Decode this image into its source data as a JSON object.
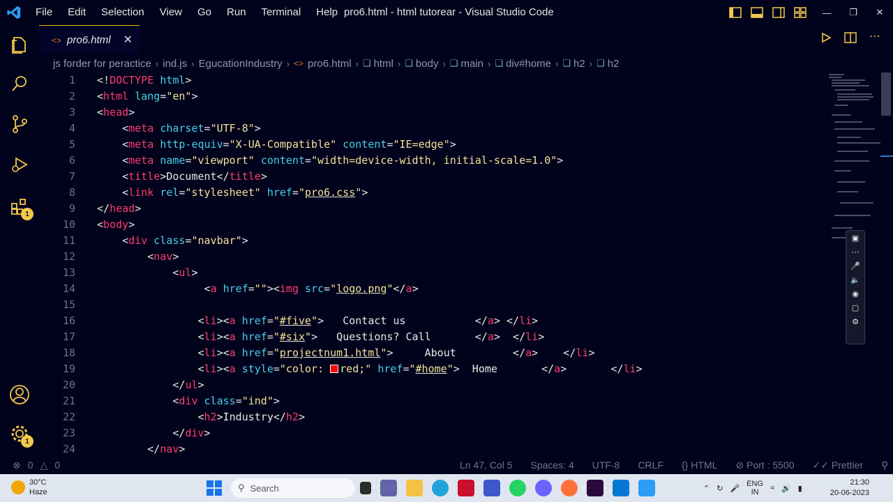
{
  "titlebar": {
    "menu": [
      "File",
      "Edit",
      "Selection",
      "View",
      "Go",
      "Run",
      "Terminal",
      "Help"
    ],
    "title": "pro6.html - html tutorear - Visual Studio Code",
    "controls": [
      "minimize",
      "restore",
      "close"
    ]
  },
  "activity": {
    "items": [
      "explorer-icon",
      "search-icon",
      "source-control-icon",
      "run-debug-icon",
      "extensions-icon"
    ],
    "extensions_badge": "1",
    "bottom": [
      "accounts-icon",
      "manage-gear-icon"
    ],
    "gear_badge": "1"
  },
  "tab": {
    "label": "pro6.html",
    "icon_text": "<>",
    "close": "✕"
  },
  "breadcrumbs": [
    "js forder for peractice",
    "ind.js",
    "EgucationIndustry",
    "pro6.html",
    "html",
    "body",
    "main",
    "div#home",
    "h2",
    "h2"
  ],
  "editor": {
    "line_numbers": [
      "1",
      "2",
      "3",
      "4",
      "5",
      "6",
      "7",
      "8",
      "9",
      "10",
      "11",
      "12",
      "13",
      "14",
      "15",
      "16",
      "17",
      "18",
      "19",
      "20",
      "21",
      "22",
      "23",
      "24"
    ]
  },
  "statusbar": {
    "errors": "0",
    "warnings": "0",
    "position": "Ln 47, Col 5",
    "spaces": "Spaces: 4",
    "encoding": "UTF-8",
    "eol": "CRLF",
    "language": "HTML",
    "port": "Port : 5500",
    "formatter": "Prettier"
  },
  "taskbar": {
    "temperature": "30°C",
    "condition": "Haze",
    "search_placeholder": "Search",
    "lang_top": "ENG",
    "lang_bottom": "IN",
    "time": "21:30",
    "date": "20-06-2023"
  },
  "colors": {
    "background": "#01021b",
    "tag": "#ff3e6e",
    "attribute": "#48d1ea",
    "string": "#f2e39c",
    "tab_border": "#f7b500",
    "badge": "#f2c94c"
  }
}
